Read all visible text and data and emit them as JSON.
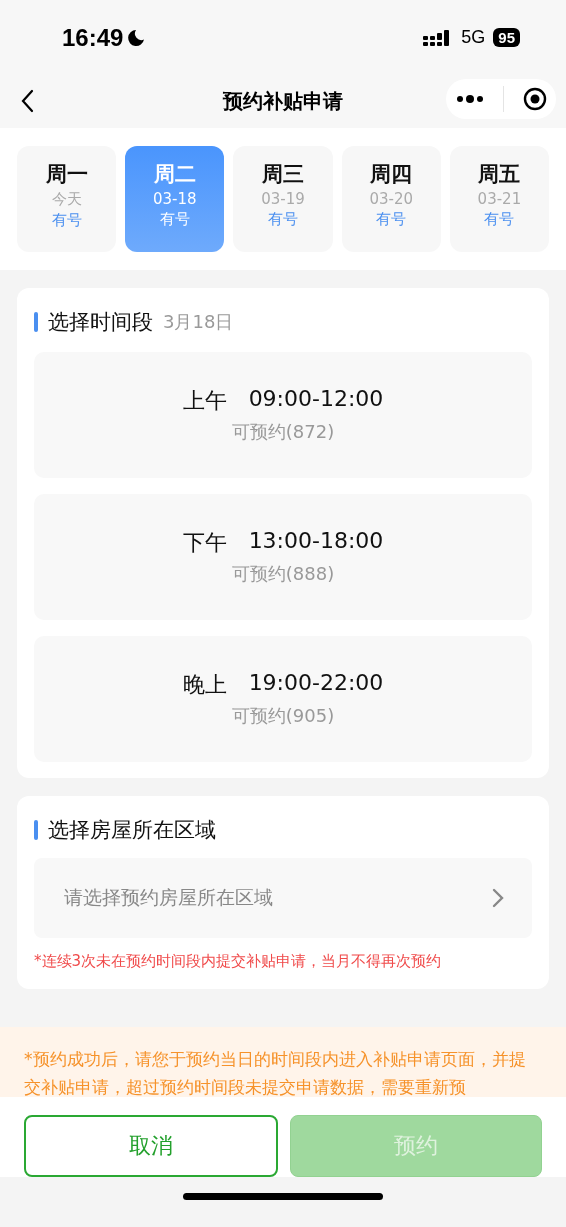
{
  "status_bar": {
    "time": "16:49",
    "network": "5G",
    "battery": "95"
  },
  "nav": {
    "title": "预约补贴申请"
  },
  "days": [
    {
      "weekday": "周一",
      "date": "今天",
      "availability": "有号",
      "selected": false
    },
    {
      "weekday": "周二",
      "date": "03-18",
      "availability": "有号",
      "selected": true
    },
    {
      "weekday": "周三",
      "date": "03-19",
      "availability": "有号",
      "selected": false
    },
    {
      "weekday": "周四",
      "date": "03-20",
      "availability": "有号",
      "selected": false
    },
    {
      "weekday": "周五",
      "date": "03-21",
      "availability": "有号",
      "selected": false
    }
  ],
  "time_section": {
    "title": "选择时间段",
    "date": "3月18日",
    "slots": [
      {
        "period": "上午",
        "time": "09:00-12:00",
        "availability": "可预约(872)",
        "selected": false
      },
      {
        "period": "下午",
        "time": "13:00-18:00",
        "availability": "可预约(888)",
        "selected": false
      },
      {
        "period": "晚上",
        "time": "19:00-22:00",
        "availability": "可预约(905)",
        "selected": false
      }
    ]
  },
  "area_section": {
    "title": "选择房屋所在区域",
    "placeholder": "请选择预约房屋所在区域",
    "warning": "*连续3次未在预约时间段内提交补贴申请，当月不得再次预约"
  },
  "notice": "*预约成功后，请您于预约当日的时间段内进入补贴申请页面，并提交补贴申请，超过预约时间段未提交申请数据，需要重新预",
  "buttons": [
    {
      "label": "取消",
      "kind": "secondary",
      "disabled": false
    },
    {
      "label": "预约",
      "kind": "primary",
      "disabled": true
    }
  ]
}
